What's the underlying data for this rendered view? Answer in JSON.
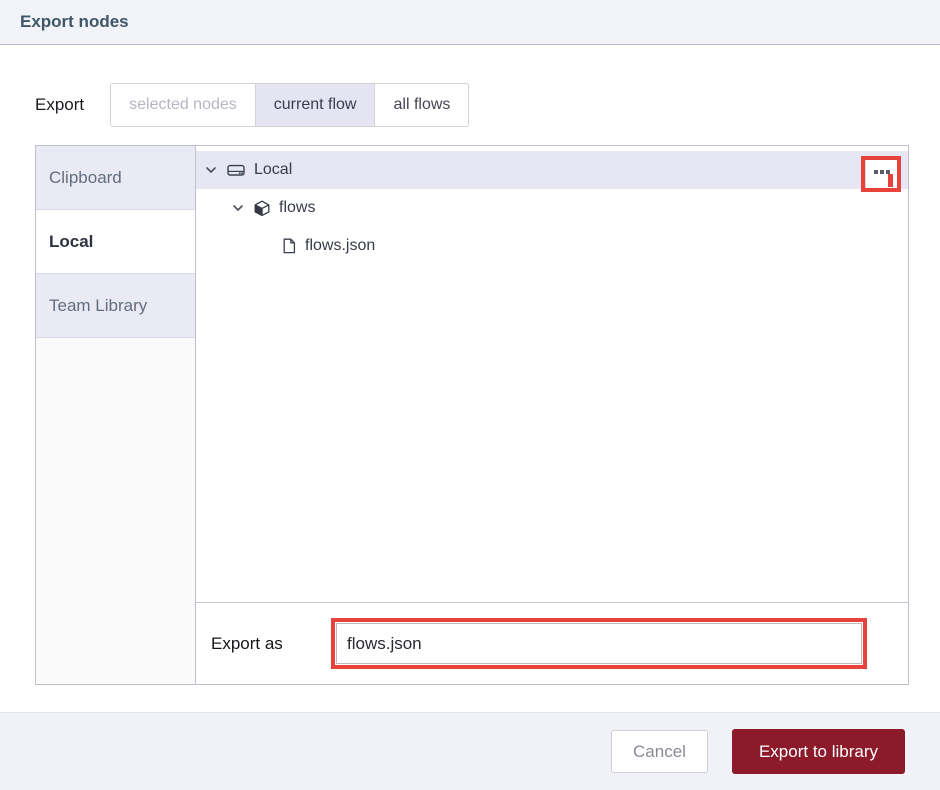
{
  "dialog": {
    "title": "Export nodes"
  },
  "export_row": {
    "label": "Export",
    "options": [
      {
        "label": "selected nodes",
        "state": "disabled"
      },
      {
        "label": "current flow",
        "state": "selected"
      },
      {
        "label": "all flows",
        "state": "normal"
      }
    ]
  },
  "sidebar": {
    "tabs": [
      {
        "label": "Clipboard",
        "active": false
      },
      {
        "label": "Local",
        "active": true
      },
      {
        "label": "Team Library",
        "active": false
      }
    ]
  },
  "tree": {
    "items": [
      {
        "label": "Local",
        "icon": "hard-drive-icon",
        "level": 0,
        "expanded": true,
        "selected": true
      },
      {
        "label": "flows",
        "icon": "cube-icon",
        "level": 1,
        "expanded": true,
        "selected": false
      },
      {
        "label": "flows.json",
        "icon": "file-icon",
        "level": 2,
        "expanded": false,
        "selected": false
      }
    ],
    "menu_icon": "ellipsis-icon"
  },
  "export_as": {
    "label": "Export as",
    "filename": "flows.json"
  },
  "footer": {
    "cancel_label": "Cancel",
    "submit_label": "Export to library"
  },
  "colors": {
    "accent_maroon": "#8c1a2b",
    "annotation_red": "#e8423c",
    "selected_segment_bg": "#e4e4f2",
    "selected_row_bg": "#e7e7f4",
    "header_bg": "#f2f2f9"
  }
}
